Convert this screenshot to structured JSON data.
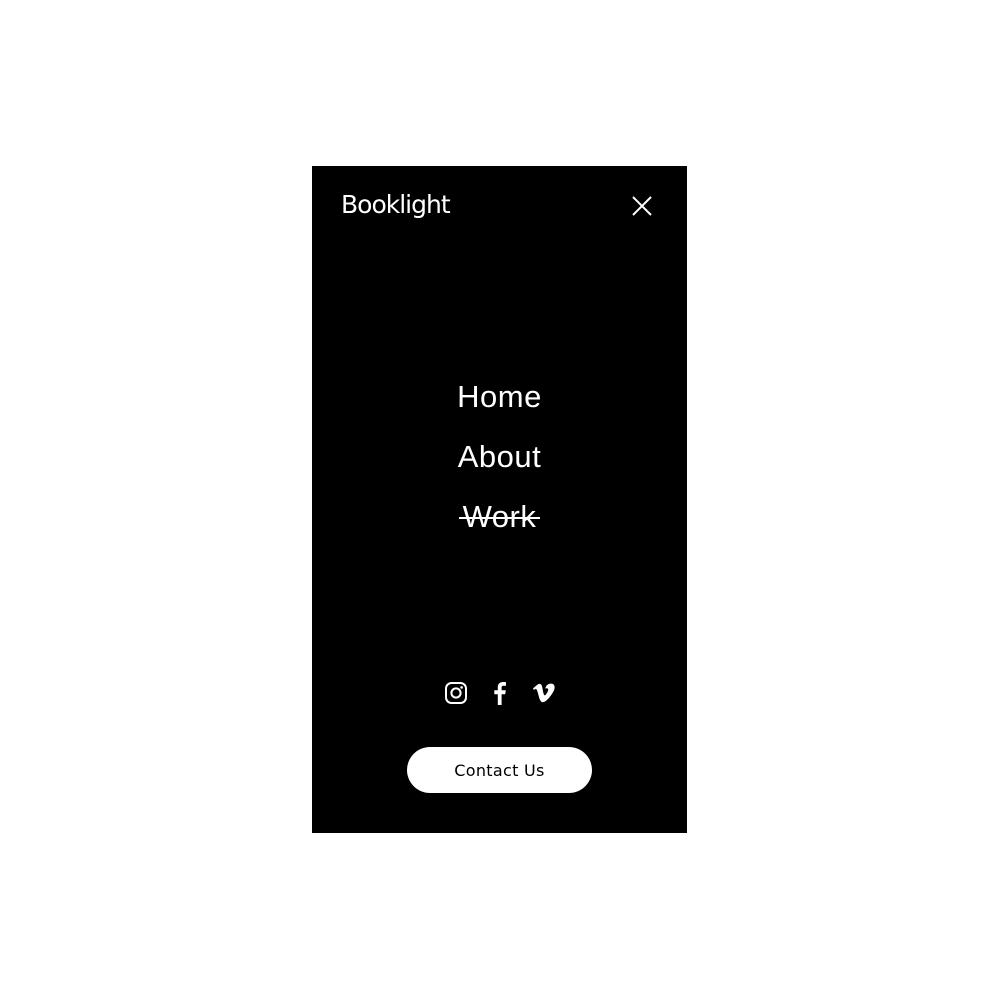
{
  "header": {
    "logo_text": "Booklight",
    "close_icon": "close-icon"
  },
  "nav": {
    "items": [
      {
        "label": "Home",
        "struck": false
      },
      {
        "label": "About",
        "struck": false
      },
      {
        "label": "Work",
        "struck": true
      }
    ]
  },
  "social": {
    "icons": [
      "instagram-icon",
      "facebook-icon",
      "vimeo-icon"
    ]
  },
  "cta": {
    "label": "Contact Us"
  },
  "colors": {
    "menu_background": "#000000",
    "text": "#ffffff",
    "button_background": "#ffffff",
    "button_text": "#000000"
  }
}
